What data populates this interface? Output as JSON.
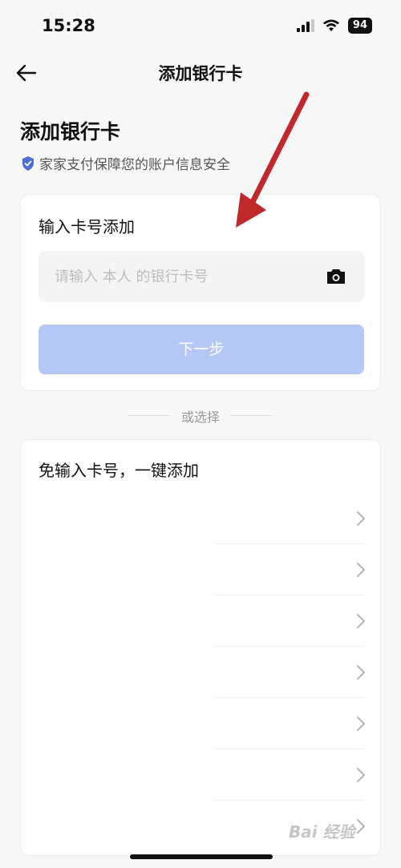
{
  "status_bar": {
    "time": "15:28",
    "battery": "94"
  },
  "nav": {
    "title": "添加银行卡"
  },
  "page": {
    "heading": "添加银行卡",
    "security_note": "家家支付保障您的账户信息安全"
  },
  "manual_card": {
    "title": "输入卡号添加",
    "input_placeholder": "请输入 本人 的银行卡号",
    "input_value": "",
    "next_button": "下一步"
  },
  "divider": {
    "text": "或选择"
  },
  "quick_card": {
    "title": "免输入卡号，一键添加",
    "rows": 7
  },
  "watermark": {
    "text": "Bai 经验"
  },
  "colors": {
    "accent": "#b4c7f5",
    "shield": "#4a6fd8",
    "annotation_arrow": "#c0282a"
  },
  "icons": {
    "back": "back-arrow-icon",
    "camera": "camera-icon",
    "shield": "shield-check-icon",
    "chevron": "chevron-right-icon"
  }
}
